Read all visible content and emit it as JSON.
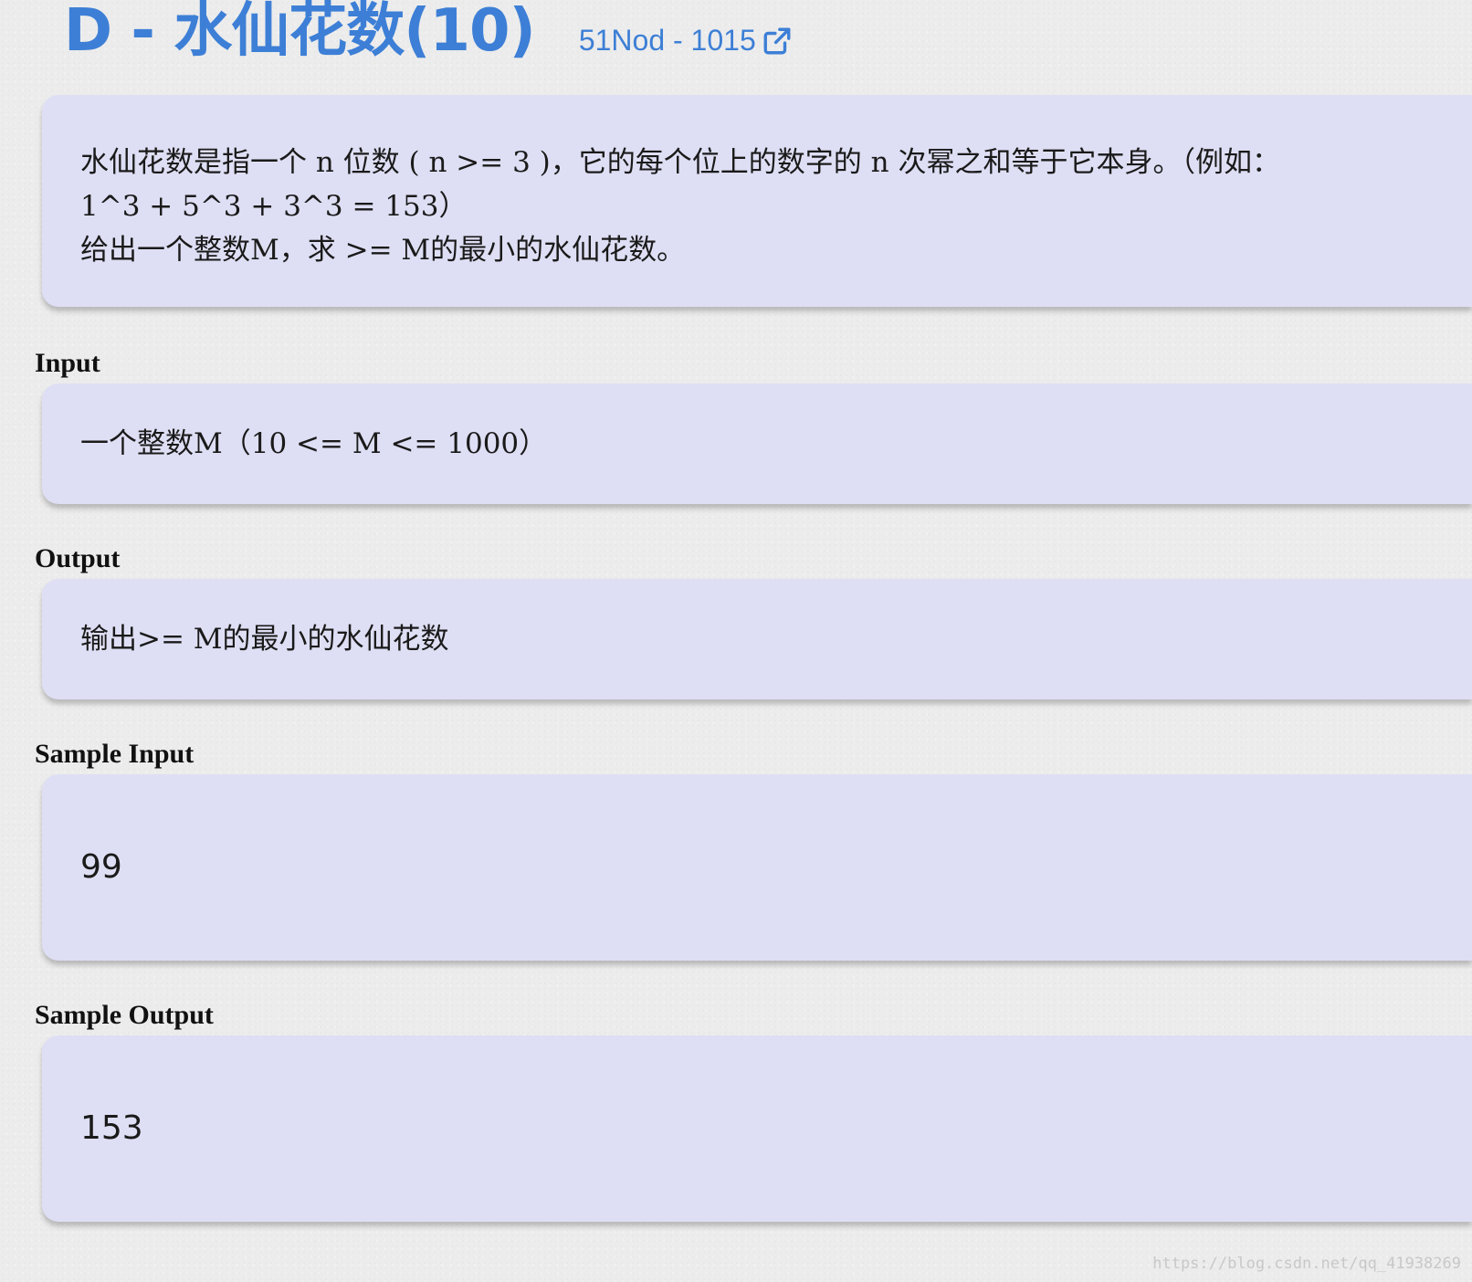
{
  "header": {
    "title": "D - 水仙花数(10)",
    "source_link": "51Nod - 1015",
    "source_icon": "external-link-icon",
    "accent_color": "#3d7fd6"
  },
  "description": {
    "line1": "水仙花数是指一个 n 位数 ( n >= 3 )，它的每个位上的数字的 n 次幂之和等于它本身。（例如：",
    "line2": "1^3 + 5^3 + 3^3 = 153）",
    "line3": "给出一个整数M，求 >= M的最小的水仙花数。"
  },
  "input": {
    "label": "Input",
    "text": "一个整数M（10 <= M <= 1000）"
  },
  "output": {
    "label": "Output",
    "text": "输出>= M的最小的水仙花数"
  },
  "sample_input": {
    "label": "Sample Input",
    "text": "99"
  },
  "sample_output": {
    "label": "Sample Output",
    "text": "153"
  },
  "watermark": "https://blog.csdn.net/qq_41938269",
  "panel_color": "#dedff4"
}
